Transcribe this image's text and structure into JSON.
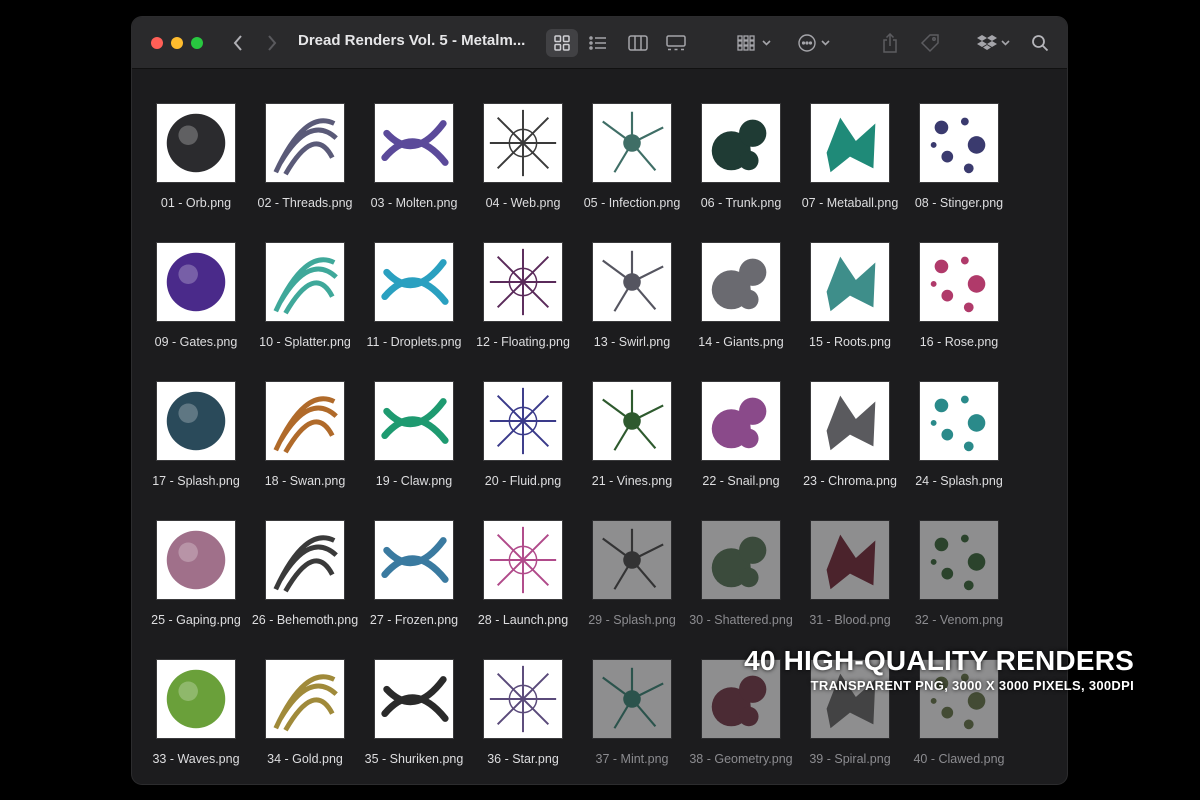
{
  "window": {
    "title": "Dread Renders Vol. 5 - Metalm...",
    "traffic_lights": {
      "close": "#ff5f57",
      "minimize": "#febc2e",
      "zoom": "#28c840"
    }
  },
  "toolbar": {
    "icons": [
      "chevron-left-icon",
      "chevron-right-icon",
      "grid-view-icon",
      "list-view-icon",
      "column-view-icon",
      "gallery-view-icon",
      "group-by-icon",
      "more-actions-icon",
      "share-icon",
      "tag-icon",
      "dropbox-icon",
      "search-icon"
    ],
    "active_view": "grid"
  },
  "files": [
    {
      "name": "01 - Orb.png",
      "color": "#2b2b2e"
    },
    {
      "name": "02 - Threads.png",
      "color": "#5a5a78"
    },
    {
      "name": "03 - Molten.png",
      "color": "#5b4a9a"
    },
    {
      "name": "04 - Web.png",
      "color": "#3a3a3a"
    },
    {
      "name": "05 - Infection.png",
      "color": "#3f6e66"
    },
    {
      "name": "06 - Trunk.png",
      "color": "#1f3b34"
    },
    {
      "name": "07 - Metaball.png",
      "color": "#1f8a78"
    },
    {
      "name": "08 - Stinger.png",
      "color": "#3a3a6e"
    },
    {
      "name": "09 - Gates.png",
      "color": "#4a2a8a"
    },
    {
      "name": "10 - Splatter.png",
      "color": "#3fa89a"
    },
    {
      "name": "11 - Droplets.png",
      "color": "#2aa0c0"
    },
    {
      "name": "12 - Floating.png",
      "color": "#5a2a5a"
    },
    {
      "name": "13 - Swirl.png",
      "color": "#555560"
    },
    {
      "name": "14 - Giants.png",
      "color": "#6a6a70"
    },
    {
      "name": "15 - Roots.png",
      "color": "#3e8e8a"
    },
    {
      "name": "16 - Rose.png",
      "color": "#b03a6a"
    },
    {
      "name": "17 - Splash.png",
      "color": "#2a4a5a"
    },
    {
      "name": "18 - Swan.png",
      "color": "#b06a2a"
    },
    {
      "name": "19 - Claw.png",
      "color": "#1e9a70"
    },
    {
      "name": "20 - Fluid.png",
      "color": "#3a3a8a"
    },
    {
      "name": "21 - Vines.png",
      "color": "#2e5a2e"
    },
    {
      "name": "22 - Snail.png",
      "color": "#8a4a8a"
    },
    {
      "name": "23 - Chroma.png",
      "color": "#5a5a5e"
    },
    {
      "name": "24 - Splash.png",
      "color": "#2a8a8a"
    },
    {
      "name": "25 - Gaping.png",
      "color": "#a0708a"
    },
    {
      "name": "26 - Behemoth.png",
      "color": "#3a3a3a"
    },
    {
      "name": "27 -  Frozen.png",
      "color": "#3a7aa0"
    },
    {
      "name": "28 - Launch.png",
      "color": "#b04a8a"
    },
    {
      "name": "29 - Splash.png",
      "color": "#4a4a4a"
    },
    {
      "name": "30 - Shattered.png",
      "color": "#5a7a5a"
    },
    {
      "name": "31 - Blood.png",
      "color": "#7a2a3a"
    },
    {
      "name": "32 - Venom.png",
      "color": "#3a6a3a"
    },
    {
      "name": "33 - Waves.png",
      "color": "#6aa03a"
    },
    {
      "name": "34 - Gold.png",
      "color": "#a08a3a"
    },
    {
      "name": "35 - Shuriken.png",
      "color": "#2a2a2a"
    },
    {
      "name": "36 - Star.png",
      "color": "#5a4a7a"
    },
    {
      "name": "37 - Mint.png",
      "color": "#3a8a7a"
    },
    {
      "name": "38 - Geometry.png",
      "color": "#7a3a4a"
    },
    {
      "name": "39 - Spiral.png",
      "color": "#6a6a6a"
    },
    {
      "name": "40 - Clawed.png",
      "color": "#6a7a4a"
    }
  ],
  "faded_files": [
    29,
    30,
    31,
    32,
    37,
    38,
    39,
    40
  ],
  "overlay": {
    "headline": "40 HIGH-QUALITY RENDERS",
    "subline": "TRANSPARENT PNG, 3000 X 3000 PIXELS, 300DPI"
  }
}
